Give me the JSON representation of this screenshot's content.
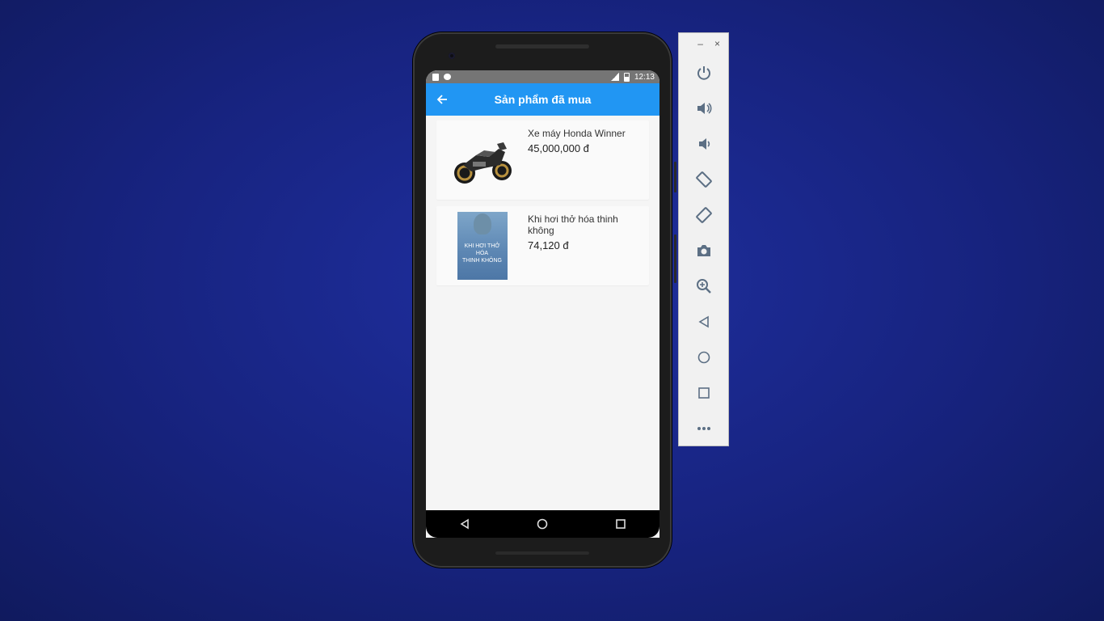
{
  "status_bar": {
    "time": "12:13"
  },
  "app_bar": {
    "title": "Sản phẩm đã mua",
    "back_icon": "arrow-back-icon"
  },
  "products": [
    {
      "name": "Xe máy Honda Winner",
      "price": "45,000,000 đ",
      "image": "motorbike-image"
    },
    {
      "name": "Khi hơi thở hóa thinh không",
      "price": "74,120 đ",
      "image": "book-cover-image",
      "cover_text": [
        "KHI HƠI THỞ",
        "HÓA",
        "THINH KHÔNG"
      ]
    }
  ],
  "nav_bar": {
    "back": "back-triangle-icon",
    "home": "home-circle-icon",
    "recents": "recents-square-icon"
  },
  "emulator_toolbar": {
    "minimize": "–",
    "close": "×",
    "buttons": [
      "power-icon",
      "volume-up-icon",
      "volume-down-icon",
      "rotate-left-icon",
      "rotate-right-icon",
      "camera-icon",
      "zoom-icon",
      "back-icon",
      "home-icon",
      "overview-icon",
      "more-icon"
    ]
  },
  "colors": {
    "appbar": "#2196f3",
    "statusbar": "#757575",
    "background": "#17237f"
  }
}
